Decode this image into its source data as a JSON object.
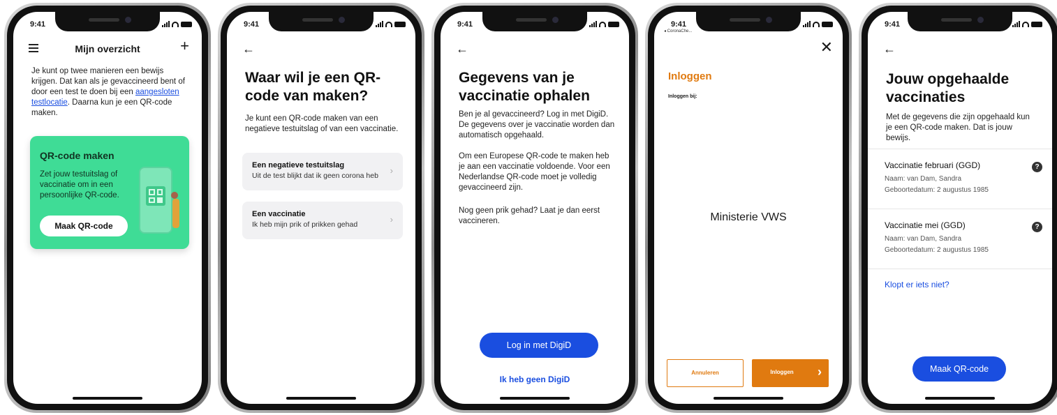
{
  "status": {
    "time": "9:41",
    "back_app": "◂ CoronaChe..."
  },
  "screen1": {
    "title": "Mijn overzicht",
    "intro_before_link": "Je kunt op twee manieren een bewijs krijgen. Dat kan als je gevaccineerd bent of door een test te doen bij een ",
    "intro_link": "aangesloten testlocatie",
    "intro_after_link": ". Daarna kun je een QR-code maken.",
    "card_title": "QR-code maken",
    "card_text": "Zet jouw testuitslag of vaccinatie om in een persoonlijke QR-code.",
    "card_button": "Maak QR-code",
    "accent": "#3fdc96"
  },
  "screen2": {
    "title": "Waar wil je een QR-code van maken?",
    "intro": "Je kunt een QR-code maken van een negatieve testuitslag of van een vaccinatie.",
    "options": [
      {
        "title": "Een negatieve testuitslag",
        "subtitle": "Uit de test blijkt dat ik geen corona heb"
      },
      {
        "title": "Een vaccinatie",
        "subtitle": "Ik heb mijn prik of prikken gehad"
      }
    ]
  },
  "screen3": {
    "title": "Gegevens van je vaccinatie ophalen",
    "para1": "Ben je al gevaccineerd? Log in met DigiD. De gegevens over je vaccinatie worden dan automatisch opgehaald.",
    "para2": "Om een Europese QR-code te maken heb je aan een vaccinatie voldoende. Voor een Nederlandse QR-code moet je volledig gevaccineerd zijn.",
    "para3": "Nog geen prik gehad? Laat je dan eerst vaccineren.",
    "login_button": "Log in met DigiD",
    "no_digid_link": "Ik heb geen DigiD"
  },
  "screen4": {
    "title": "Inloggen",
    "subtitle": "Inloggen bij:",
    "provider": "Ministerie VWS",
    "cancel_button": "Annuleren",
    "login_button": "Inloggen",
    "accent": "#e07a10"
  },
  "screen5": {
    "title": "Jouw opgehaalde vaccinaties",
    "intro": "Met de gegevens die zijn opgehaald kun je een QR-code maken. Dat is jouw bewijs.",
    "vaccinations": [
      {
        "title": "Vaccinatie februari (GGD)",
        "name": "Naam: van Dam, Sandra",
        "dob": "Geboortedatum: 2 augustus 1985"
      },
      {
        "title": "Vaccinatie mei (GGD)",
        "name": "Naam: van Dam, Sandra",
        "dob": "Geboortedatum: 2 augustus 1985"
      }
    ],
    "wrong_link": "Klopt er iets niet?",
    "button": "Maak QR-code"
  },
  "icons": [
    "menu-icon",
    "plus-icon",
    "back-arrow-icon",
    "chevron-right-icon",
    "close-icon",
    "help-icon",
    "qr-code-icon"
  ]
}
